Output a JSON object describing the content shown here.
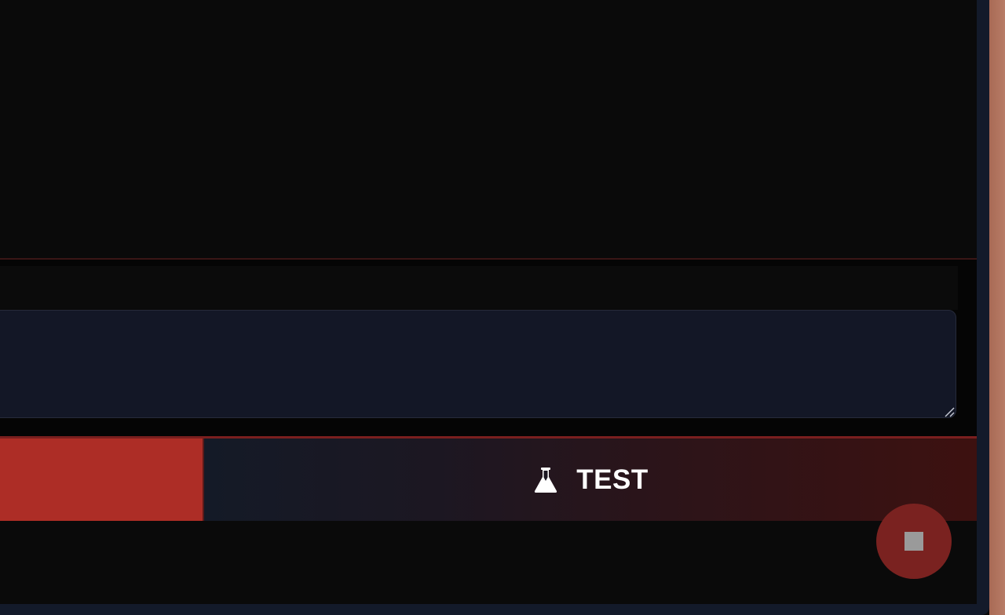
{
  "editor": {
    "input_value": "",
    "input_placeholder": ""
  },
  "actions": {
    "run_label": "",
    "test_label": "TEST",
    "test_icon": "flask-icon",
    "stop_icon": "stop-icon"
  },
  "colors": {
    "accent_red": "#ad2d26",
    "stop_fab": "#7a2220",
    "textarea_bg": "#131726",
    "background": "#0a0a0a"
  }
}
